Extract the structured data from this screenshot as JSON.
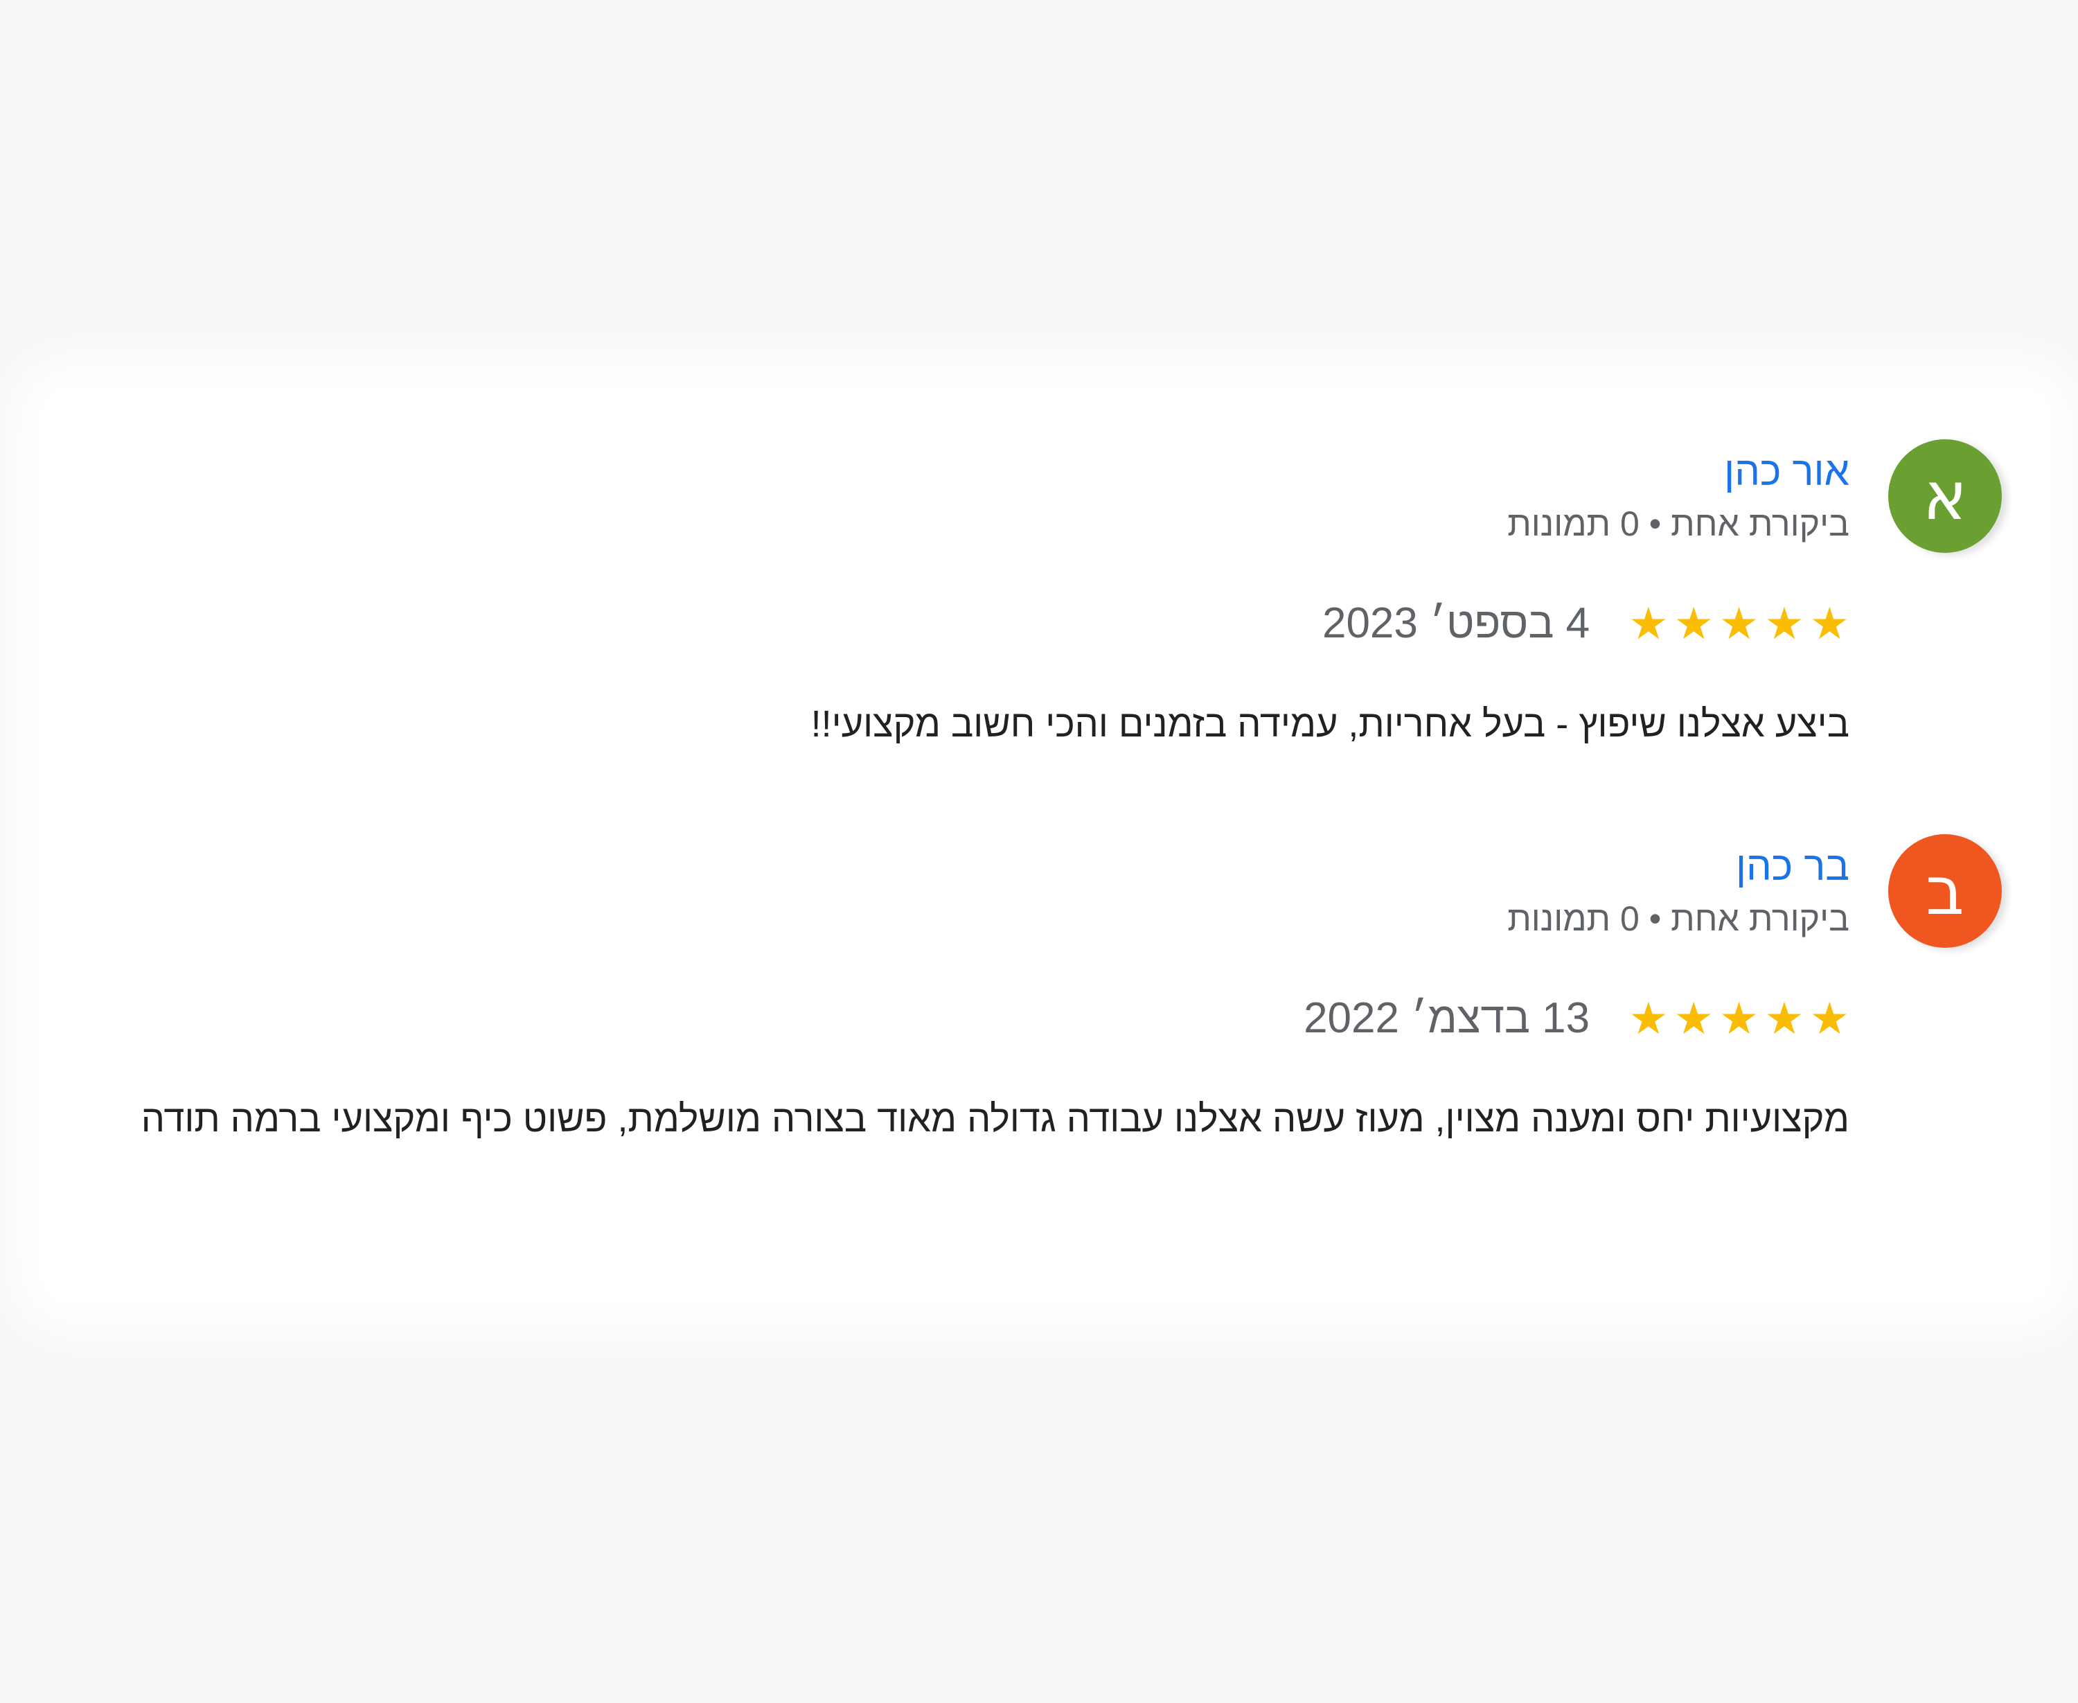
{
  "reviews": [
    {
      "avatar_letter": "א",
      "avatar_color": "#6aa032",
      "name": "אור כהן",
      "meta": "ביקורת אחת • 0 תמונות",
      "rating": 5,
      "date": "4 בספט׳ 2023",
      "text": "ביצע אצלנו שיפוץ - בעל אחריות, עמידה בזמנים והכי חשוב מקצועי!!"
    },
    {
      "avatar_letter": "ב",
      "avatar_color": "#f0561f",
      "name": "בר כהן",
      "meta": "ביקורת אחת • 0 תמונות",
      "rating": 5,
      "date": "13 בדצמ׳ 2022",
      "text": "מקצועיות יחס ומענה מצוין, מעוז עשה אצלנו עבודה גדולה מאוד בצורה מושלמת, פשוט כיף ומקצועי ברמה תודה"
    }
  ],
  "colors": {
    "name": "#1a73e8",
    "meta": "#5f6368",
    "star": "#fbbc04",
    "body_text": "#202124"
  },
  "icons": {
    "star": "star-icon"
  }
}
